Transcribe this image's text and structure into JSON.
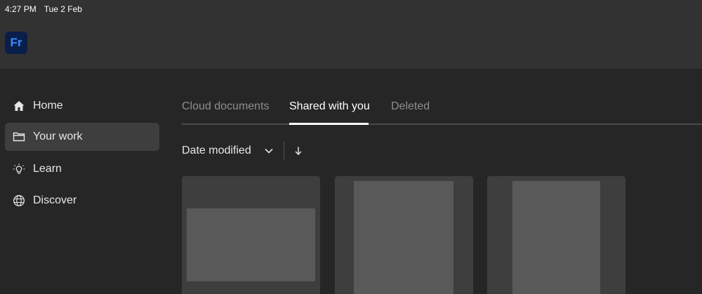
{
  "statusbar": {
    "time": "4:27 PM",
    "date": "Tue 2 Feb"
  },
  "app": {
    "logo_text": "Fr",
    "logo_color": "#3a8bff"
  },
  "sidebar": {
    "items": [
      {
        "label": "Home",
        "icon": "home-icon",
        "active": false
      },
      {
        "label": "Your work",
        "icon": "folder-icon",
        "active": true
      },
      {
        "label": "Learn",
        "icon": "lightbulb-icon",
        "active": false
      },
      {
        "label": "Discover",
        "icon": "globe-icon",
        "active": false
      }
    ]
  },
  "tabs": [
    {
      "label": "Cloud documents",
      "active": false
    },
    {
      "label": "Shared with you",
      "active": true
    },
    {
      "label": "Deleted",
      "active": false
    }
  ],
  "sort": {
    "label": "Date modified",
    "chevron_icon": "chevron-down-icon",
    "direction_icon": "arrow-down-icon"
  },
  "documents": [
    {
      "orientation": "landscape"
    },
    {
      "orientation": "portrait"
    },
    {
      "orientation": "portrait"
    }
  ]
}
